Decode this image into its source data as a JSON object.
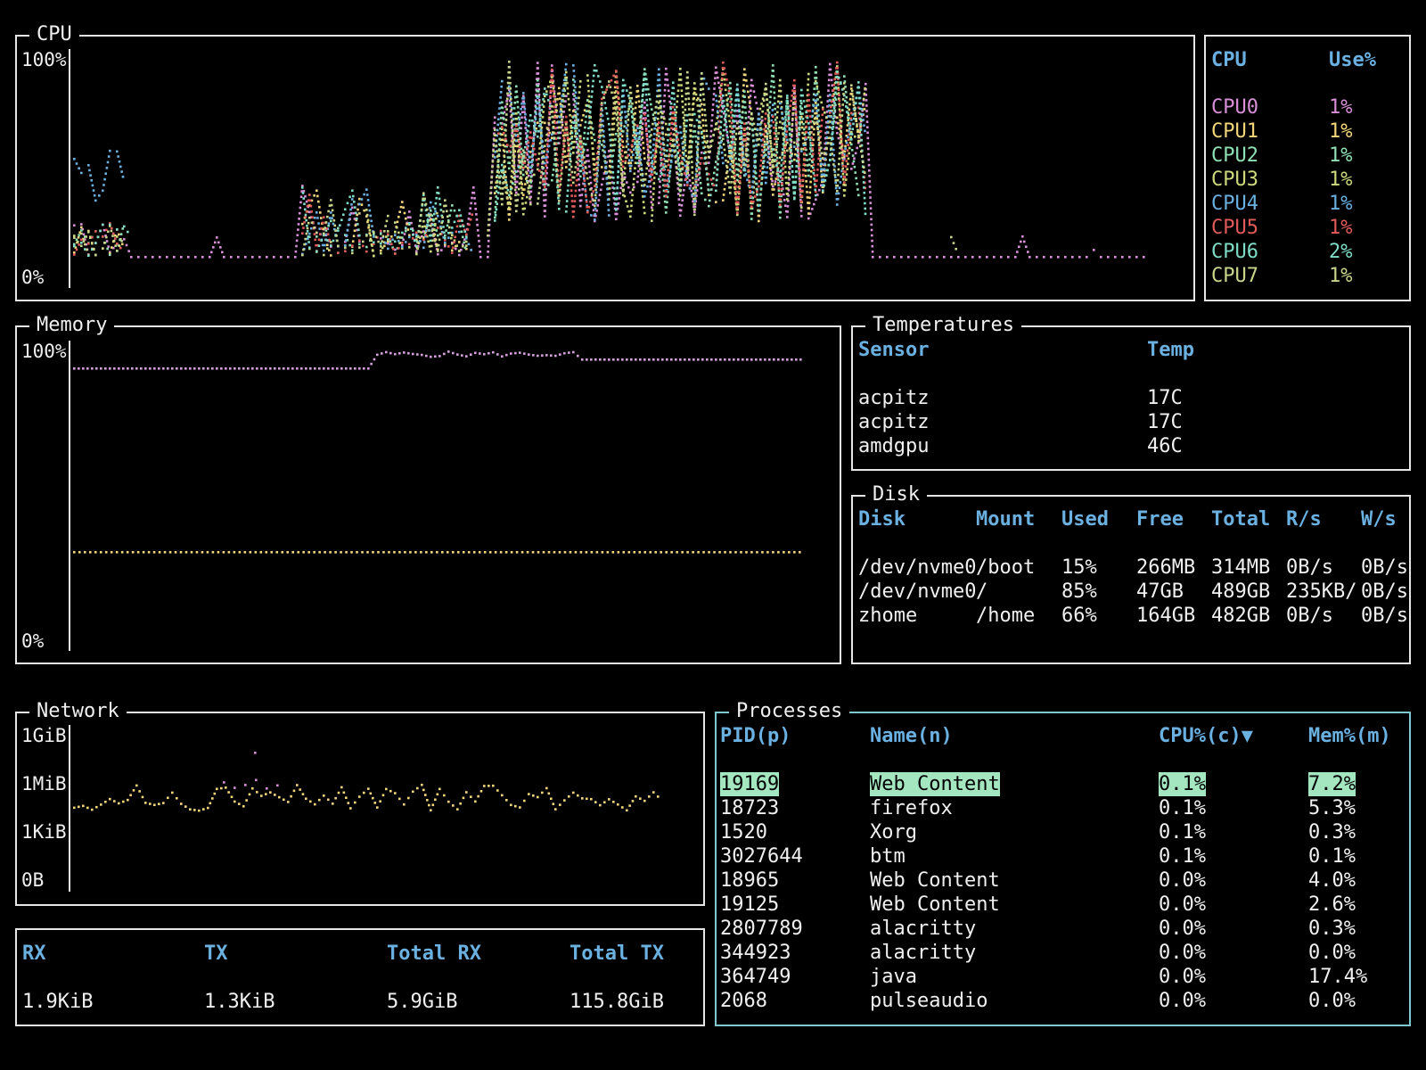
{
  "cpu": {
    "title": "CPU",
    "axis_top": "100%",
    "axis_bottom": "0%",
    "table_headers": [
      "CPU",
      "Use%"
    ],
    "cores": [
      {
        "name": "CPU0",
        "use": "1%",
        "color": "#d88fd8"
      },
      {
        "name": "CPU1",
        "use": "1%",
        "color": "#f2d67a"
      },
      {
        "name": "CPU2",
        "use": "1%",
        "color": "#8fe0b4"
      },
      {
        "name": "CPU3",
        "use": "1%",
        "color": "#cdd97a"
      },
      {
        "name": "CPU4",
        "use": "1%",
        "color": "#6ab0e0"
      },
      {
        "name": "CPU5",
        "use": "1%",
        "color": "#e05a5a"
      },
      {
        "name": "CPU6",
        "use": "2%",
        "color": "#7fdcc8"
      },
      {
        "name": "CPU7",
        "use": "1%",
        "color": "#c7d68a"
      }
    ]
  },
  "memory": {
    "title": "Memory",
    "axis_top": "100%",
    "axis_bottom": "0%",
    "series_colors": [
      "#d8a0e0",
      "#f2d67a"
    ]
  },
  "temperatures": {
    "title": "Temperatures",
    "headers": [
      "Sensor",
      "Temp"
    ],
    "rows": [
      [
        "acpitz",
        "17C"
      ],
      [
        "acpitz",
        "17C"
      ],
      [
        "amdgpu",
        "46C"
      ]
    ]
  },
  "disk": {
    "title": "Disk",
    "headers": [
      "Disk",
      "Mount",
      "Used",
      "Free",
      "Total",
      "R/s",
      "W/s"
    ],
    "rows": [
      [
        "/dev/nvme0",
        "/boot",
        "15%",
        "266MB",
        "314MB",
        "0B/s",
        "0B/s"
      ],
      [
        "/dev/nvme0",
        "/",
        "85%",
        "47GB",
        "489GB",
        "235KB/",
        "0B/s"
      ],
      [
        "zhome",
        "/home",
        "66%",
        "164GB",
        "482GB",
        "0B/s",
        "0B/s"
      ]
    ]
  },
  "network": {
    "title": "Network",
    "axis_labels": [
      "1GiB",
      "1MiB",
      "1KiB",
      "0B"
    ],
    "series_colors": [
      "#f2d67a",
      "#d88fd8"
    ],
    "summary_headers": [
      "RX",
      "TX",
      "Total RX",
      "Total TX"
    ],
    "summary_values": [
      "1.9KiB",
      "1.3KiB",
      "5.9GiB",
      "115.8GiB"
    ]
  },
  "processes": {
    "title": "Processes",
    "headers": [
      "PID(p)",
      "Name(n)",
      "CPU%(c)▼",
      "Mem%(m)"
    ],
    "selected_index": 0,
    "rows": [
      [
        "19169",
        "Web Content",
        "0.1%",
        "7.2%"
      ],
      [
        "18723",
        "firefox",
        "0.1%",
        "5.3%"
      ],
      [
        "1520",
        "Xorg",
        "0.1%",
        "0.3%"
      ],
      [
        "3027644",
        "btm",
        "0.1%",
        "0.1%"
      ],
      [
        "18965",
        "Web Content",
        "0.0%",
        "4.0%"
      ],
      [
        "19125",
        "Web Content",
        "0.0%",
        "2.6%"
      ],
      [
        "2807789",
        "alacritty",
        "0.0%",
        "0.3%"
      ],
      [
        "344923",
        "alacritty",
        "0.0%",
        "0.0%"
      ],
      [
        "364749",
        "java",
        "0.0%",
        "17.4%"
      ],
      [
        "2068",
        "pulseaudio",
        "0.0%",
        "0.0%"
      ]
    ]
  }
}
